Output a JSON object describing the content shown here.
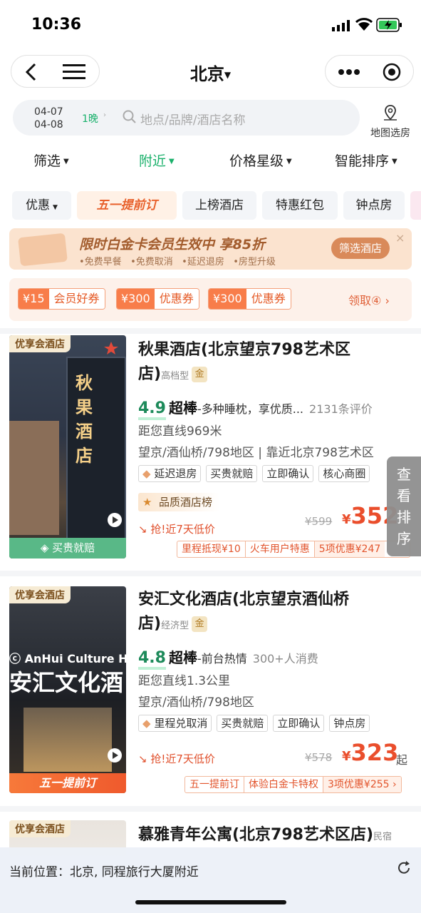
{
  "status": {
    "time": "10:36"
  },
  "nav": {
    "title": "北京"
  },
  "search": {
    "checkin": "04-07",
    "checkout": "04-08",
    "nights": "1晚",
    "placeholder": "地点/品牌/酒店名称",
    "map_label": "地图选房"
  },
  "filters": [
    {
      "label": "筛选",
      "active": false
    },
    {
      "label": "附近",
      "active": true
    },
    {
      "label": "价格星级",
      "active": false
    },
    {
      "label": "智能排序",
      "active": false
    }
  ],
  "chips": [
    "优惠",
    "五一提前订",
    "上榜酒店",
    "特惠红包",
    "钟点房"
  ],
  "banner": {
    "title": "限时白金卡会员生效中 享85折",
    "subs": [
      "•免费早餐",
      "•免费取消",
      "•延迟退房",
      "•房型升级"
    ],
    "button": "筛选酒店",
    "close": "×"
  },
  "coupons": {
    "items": [
      {
        "amount": "¥15",
        "name": "会员好券"
      },
      {
        "amount": "¥300",
        "name": "优惠券"
      },
      {
        "amount": "¥300",
        "name": "优惠券"
      }
    ],
    "claim": "领取④"
  },
  "hotels": [
    {
      "badge": "优享会酒店",
      "name_line1": "秋果酒店(北京望京798艺术区",
      "name_line2": "店)",
      "class": "高档型",
      "gold": "金",
      "score": "4.9",
      "level": "超棒",
      "highlight": "-多种睡枕，享优质...",
      "reviews": "2131条评价",
      "distance": "距您直线969米",
      "area": "望京/酒仙桥/798地区 | 靠近北京798艺术区",
      "tags": [
        "延迟退房",
        "买贵就赔",
        "立即确认",
        "核心商圈"
      ],
      "rank": "品质酒店榜",
      "low": "抢!近7天低价",
      "old_price": "¥599",
      "price": "352",
      "img_footer": "买贵就赔",
      "img_sign": [
        "秋",
        "果",
        "酒",
        "店"
      ],
      "perks": [
        "里程抵现¥10",
        "火车用户特惠",
        "5项优惠¥247"
      ]
    },
    {
      "badge": "优享会酒店",
      "name_line1": "安汇文化酒店(北京望京酒仙桥",
      "name_line2": "店)",
      "class": "经济型",
      "gold": "金",
      "score": "4.8",
      "level": "超棒",
      "highlight": "-前台热情",
      "reviews": "300+人消费",
      "distance": "距您直线1.3公里",
      "area": "望京/酒仙桥/798地区",
      "tags": [
        "里程兑取消",
        "买贵就赔",
        "立即确认",
        "钟点房"
      ],
      "low": "抢!近7天低价",
      "old_price": "¥578",
      "price": "323",
      "suffix": "起",
      "img_footer": "五一提前订",
      "img_brand": "AnHui Culture H",
      "img_sign": "安汇文化酒",
      "perks": [
        "五一提前订",
        "体验白金卡特权",
        "3项优惠¥255 ›"
      ]
    },
    {
      "badge": "优享会酒店",
      "name_line1": "慕雅青年公寓(北京798艺术区店)",
      "class": "民宿"
    }
  ],
  "fab": [
    "查",
    "看",
    "排",
    "序"
  ],
  "location": {
    "text": "当前位置：北京, 同程旅行大厦附近"
  }
}
